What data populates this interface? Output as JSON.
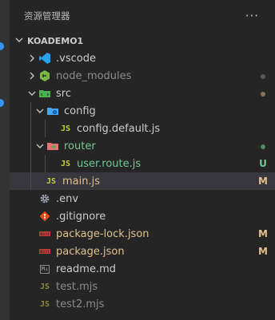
{
  "panel": {
    "title": "资源管理器",
    "more_glyph": "···"
  },
  "section": {
    "title": "KOADEMO1"
  },
  "tree": [
    {
      "label": "vscode",
      "prefix": ".",
      "color": "#cccccc"
    },
    {
      "label": "node_modules",
      "color": "#8b8b8b"
    },
    {
      "label": "src",
      "color": "#cccccc"
    },
    {
      "label": "config",
      "color": "#cccccc"
    },
    {
      "label": "config.default.js",
      "color": "#cccccc"
    },
    {
      "label": "router",
      "color": "#73c991"
    },
    {
      "label": "user.route.js",
      "color": "#73c991",
      "status": "U"
    },
    {
      "label": "main.js",
      "color": "#e2c08d",
      "status": "M"
    },
    {
      "label": ".env",
      "color": "#cccccc"
    },
    {
      "label": ".gitignore",
      "color": "#cccccc"
    },
    {
      "label": "package-lock.json",
      "color": "#e2c08d",
      "status": "M"
    },
    {
      "label": "package.json",
      "color": "#e2c08d",
      "status": "M"
    },
    {
      "label": "readme.md",
      "color": "#cccccc"
    },
    {
      "label": "test.mjs",
      "color": "#8b8b8b"
    },
    {
      "label": "test2.mjs",
      "color": "#8b8b8b"
    }
  ],
  "file_icon_text": {
    "js": "JS",
    "md": "M↓"
  },
  "colors": {
    "background": "#252526",
    "selected": "#37373d",
    "modified": "#e2c08d",
    "untracked": "#73c991",
    "ignored": "#8b8b8b",
    "accent": "#3794ff"
  }
}
